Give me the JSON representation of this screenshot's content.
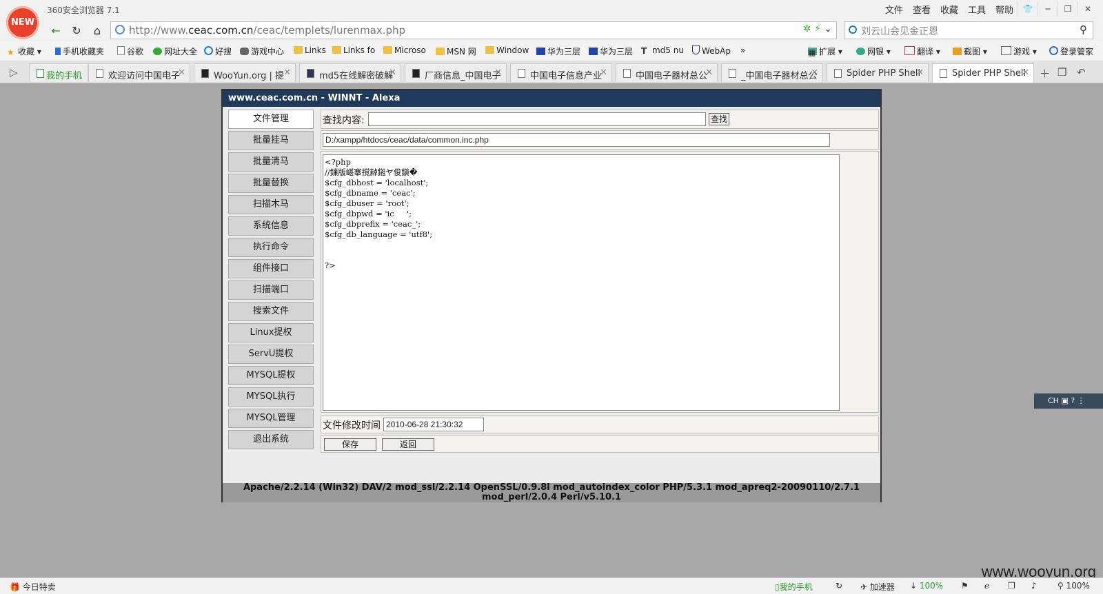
{
  "browser": {
    "title": "360安全浏览器 7.1",
    "logo_text": "NEW",
    "menu": [
      "文件",
      "查看",
      "收藏",
      "工具",
      "帮助"
    ],
    "url_prefix": "http://www.",
    "url_host": "ceac.com.cn",
    "url_path": "/ceac/templets/lurenmax.php",
    "search_text": "刘云山会见金正恩"
  },
  "bookmarks": [
    {
      "label": "收藏",
      "icon": "star-icon"
    },
    {
      "label": "手机收藏夹",
      "icon": "phone-icon"
    },
    {
      "label": "谷歌",
      "icon": "page-icon"
    },
    {
      "label": "网址大全",
      "icon": "site-icon"
    },
    {
      "label": "好搜",
      "icon": "search-icon"
    },
    {
      "label": "游戏中心",
      "icon": "gamepad-icon"
    },
    {
      "label": "Links",
      "icon": "folder-icon"
    },
    {
      "label": "Links fo",
      "icon": "folder-icon"
    },
    {
      "label": "Microso",
      "icon": "folder-icon"
    },
    {
      "label": "MSN 网",
      "icon": "folder-icon"
    },
    {
      "label": "Window",
      "icon": "folder-icon"
    },
    {
      "label": "华为三层",
      "icon": "paw-icon"
    },
    {
      "label": "华为三层",
      "icon": "paw-icon"
    },
    {
      "label": "md5 nu",
      "icon": "t-icon"
    },
    {
      "label": "WebAp",
      "icon": "shield-icon"
    }
  ],
  "right_tools": [
    {
      "label": "扩展",
      "icon": "grid-icon"
    },
    {
      "label": "网银",
      "icon": "bank-icon"
    },
    {
      "label": "翻译",
      "icon": "translate-icon"
    },
    {
      "label": "截图",
      "icon": "scissors-icon"
    },
    {
      "label": "游戏",
      "icon": "game-icon"
    },
    {
      "label": "登录管家",
      "icon": "login-icon"
    }
  ],
  "tabs": [
    {
      "label": "我的手机"
    },
    {
      "label": "欢迎访问中国电子"
    },
    {
      "label": "WooYun.org | 提"
    },
    {
      "label": "md5在线解密破解"
    },
    {
      "label": "厂商信息_中国电子"
    },
    {
      "label": "中国电子信息产业"
    },
    {
      "label": "中国电子器材总公"
    },
    {
      "label": "_中国电子器材总公"
    },
    {
      "label": "Spider PHP Shell"
    },
    {
      "label": "Spider PHP Shell"
    }
  ],
  "shell": {
    "header": "www.ceac.com.cn - WINNT - Alexa",
    "menu": [
      "文件管理",
      "批量挂马",
      "批量清马",
      "批量替换",
      "扫描木马",
      "系统信息",
      "执行命令",
      "组件接口",
      "扫描端口",
      "搜索文件",
      "Linux提权",
      "ServU提权",
      "MYSQL提权",
      "MYSQL执行",
      "MYSQL管理",
      "退出系统"
    ],
    "search_label": "查找内容:",
    "search_button": "查找",
    "file_path": "D:/xampp/htdocs/ceac/data/common.inc.php",
    "code": "<?php\n//鏁版嵁搴撹繛鎺ヤ俊鎭�\n$cfg_dbhost = 'localhost';\n$cfg_dbname = 'ceac';\n$cfg_dbuser = 'root';\n$cfg_dbpwd = 'ic     ';\n$cfg_dbprefix = 'ceac_';\n$cfg_db_language = 'utf8';\n\n\n?>",
    "mtime_label": "文件修改时间",
    "mtime_value": "2010-06-28 21:30:32",
    "save_button": "保存",
    "back_button": "返回",
    "footer": "Apache/2.2.14 (Win32) DAV/2 mod_ssl/2.2.14 OpenSSL/0.9.8l mod_autoindex_color PHP/5.3.1 mod_apreq2-20090110/2.7.1 mod_perl/2.0.4 Perl/v5.10.1"
  },
  "ime": {
    "label": "CH"
  },
  "watermark": "www.wooyun.org",
  "status": {
    "left": "今日特卖",
    "phone": "我的手机",
    "accel": "加速器",
    "download": "100%",
    "zoom": "100%"
  }
}
